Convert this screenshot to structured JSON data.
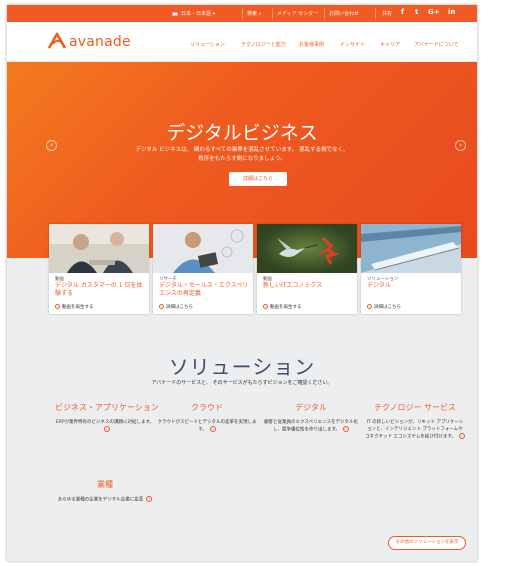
{
  "utilbar": {
    "region": "日本 - 日本語",
    "search": "検索",
    "media_center": "メディア センター",
    "contact": "お問い合わせ",
    "share": "共有",
    "social": [
      "f",
      "t",
      "G+",
      "in"
    ]
  },
  "header": {
    "logo_text": "avanade",
    "nav": [
      "ソリューション",
      "テクノロジーと能力",
      "お客様事例",
      "インサイト",
      "キャリア",
      "アバナードについて"
    ]
  },
  "hero": {
    "title": "デジタルビジネス",
    "description_line1": "デジタル ビジネスは、 関わるすべての業界を混乱させています。 混乱する側でなく、",
    "description_line2": "秩序をもたらす側になりましょう。",
    "button": "詳細はこちら",
    "prev": "‹",
    "next": "›"
  },
  "cards": [
    {
      "category": "動画",
      "title": "デジタル カスタマーの 1 日を体験する",
      "link": "動画を再生する"
    },
    {
      "category": "リサーチ",
      "title": "デジタル・セールス・エクスペリエンスの再定義",
      "link": "詳細はこちら"
    },
    {
      "category": "動画",
      "title": "新しいITエコノミクス",
      "link": "動画を再生する"
    },
    {
      "category": "ソリューション",
      "title": "デジタル",
      "link": "詳細はこちら"
    }
  ],
  "solutions": {
    "title": "ソリューション",
    "subtitle": "アバナードのサービスと、 そのサービスがもたらすビジョンをご確認ください。",
    "items": [
      {
        "title": "ビジネス・アプリケーション",
        "desc": "ERPが業界特有のビジネスの課題に対処します。"
      },
      {
        "title": "クラウド",
        "desc": "クラウドがスピードとデジタルの変革を実現します。"
      },
      {
        "title": "デジタル",
        "desc": "顧客と従業員のエクスペリエンスをデジタル化し、競争優位性を作り出します。"
      },
      {
        "title": "テクノロジー サービス",
        "desc": "IT の新しいビジョンが、リキッド アプリケーションと、インテリジェント プラットフォームやコネクテッド エコシステムを結び付けます。"
      },
      {
        "title": "業種",
        "desc": "あらゆる業種の企業をデジタル企業に変革"
      }
    ],
    "all_button": "その他のソリューションを表示"
  },
  "colors": {
    "brand": "#f15a22",
    "hero_start": "#f47b1f",
    "hero_end": "#e84a1f",
    "grey_bg": "#eceef0",
    "heading": "#3d4d6b"
  }
}
